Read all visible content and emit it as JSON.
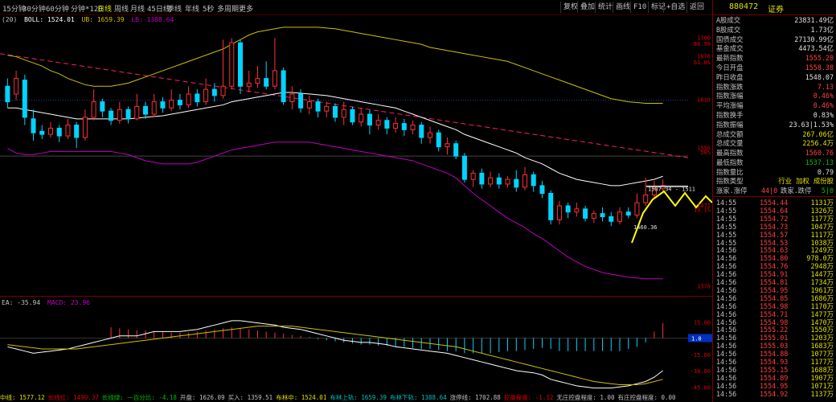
{
  "toolbar": {
    "timeframes": [
      "15分钟",
      "30分钟",
      "60分钟",
      "分钟*120",
      "日线",
      "周线",
      "月线",
      "45日线",
      "季线",
      "年线",
      "5秒",
      "多周期",
      "更多"
    ],
    "active_timeframe": "日线",
    "buttons": [
      "复权",
      "叠加",
      "统计",
      "画线",
      "F10",
      "标记",
      "+自选",
      "返回"
    ]
  },
  "main_header": {
    "label": "(20)  BOLL: 1524.01  UB: 1659.39  LB: 1388.64",
    "prefix": "(20)",
    "boll": "BOLL: 1524.01",
    "ub": "UB: 1659.39",
    "lb": "LB: 1388.64"
  },
  "price_labels": {
    "p1700": "1700",
    "p8099": "80.99",
    "p1676": "1676",
    "p6168": "61.8%",
    "p1610": "1610",
    "p1550": "1550",
    "p50": "50%",
    "p1471": "1471",
    "p1919": "19.1%",
    "p1370": "1370"
  },
  "annotations": {
    "range_label": "1507.34 - 1511",
    "low_label": "1460.36"
  },
  "macd_header": {
    "dea": "EA: -35.94",
    "macd": "MACD: 23.96"
  },
  "macd_labels": {
    "l1500": "15.00",
    "l000": "0.00",
    "l1500n": "-15.00",
    "l3000n": "-30.00",
    "l4500n": "-45.00",
    "box": "1.0"
  },
  "bottom_bar": [
    {
      "text": "中线: 1577.12",
      "color": "#e0e000"
    },
    {
      "text": "长线红: 1490.37",
      "color": "#e00000"
    },
    {
      "text": "长线绿: 一百分比: -4.18",
      "color": "#00c000"
    },
    {
      "text": "开盘: 1626.09",
      "color": "#c0c0c0"
    },
    {
      "text": "买入: 1359.51",
      "color": "#c0c0c0"
    },
    {
      "text": "布林中: 1524.01",
      "color": "#e0e000"
    },
    {
      "text": "布林上轨: 1659.39",
      "color": "#00c0c0"
    },
    {
      "text": "布林下轨: 1388.64",
      "color": "#00c0c0"
    },
    {
      "text": "涨停线: 1702.88",
      "color": "#c0c0c0"
    },
    {
      "text": "控盘程度: -1.12",
      "color": "#e00000"
    },
    {
      "text": "无庄控盘程度: 1.00",
      "color": "#c0c0c0"
    },
    {
      "text": "有庄控盘程度: 0.00",
      "color": "#c0c0c0"
    }
  ],
  "panel": {
    "code": "880472",
    "name": "证券",
    "rows": [
      {
        "k": "A股成交",
        "v": "23831.49亿",
        "c": "#e0e0e0"
      },
      {
        "k": "B股成交",
        "v": "1.73亿",
        "c": "#e0e0e0"
      },
      {
        "k": "国债成交",
        "v": "27130.99亿",
        "c": "#e0e0e0"
      },
      {
        "k": "基金成交",
        "v": "4473.54亿",
        "c": "#e0e0e0"
      },
      {
        "k": "最新指数",
        "v": "1555.20",
        "c": "#ff4040"
      },
      {
        "k": "今日开盘",
        "v": "1558.38",
        "c": "#ff4040"
      },
      {
        "k": "昨日收盘",
        "v": "1548.07",
        "c": "#e0e0e0"
      },
      {
        "k": "指数涨跌",
        "v": "7.13",
        "c": "#ff4040"
      },
      {
        "k": "指数涨幅",
        "v": "0.46%",
        "c": "#ff4040"
      },
      {
        "k": "平均涨幅",
        "v": "0.46%",
        "c": "#ff4040"
      },
      {
        "k": "指数换手",
        "v": "0.83%",
        "c": "#e0e0e0"
      },
      {
        "k": "指数振幅",
        "v": "23.63|1.53%",
        "c": "#e0e0e0"
      },
      {
        "k": "总成交额",
        "v": "267.06亿",
        "c": "#e0e000"
      },
      {
        "k": "总成交量",
        "v": "2256.4万",
        "c": "#e0e000"
      },
      {
        "k": "最高指数",
        "v": "1560.76",
        "c": "#ff4040"
      },
      {
        "k": "最低指数",
        "v": "1537.13",
        "c": "#00c000"
      },
      {
        "k": "指数量比",
        "v": "0.79",
        "c": "#e0e0e0"
      }
    ],
    "type_row": {
      "k": "指数类型",
      "v": "行业 加权 成份股"
    },
    "updown_row": {
      "k": "涨家.涨停",
      "v": "44|0",
      "k2": "跌家.跌停",
      "v2": "5|0"
    },
    "ticks": [
      {
        "t": "14:55",
        "p": "1554.44",
        "v": "1131万"
      },
      {
        "t": "14:55",
        "p": "1554.64",
        "v": "1326万"
      },
      {
        "t": "14:55",
        "p": "1554.72",
        "v": "1177万"
      },
      {
        "t": "14:55",
        "p": "1554.73",
        "v": "1047万"
      },
      {
        "t": "14:55",
        "p": "1554.57",
        "v": "1117万"
      },
      {
        "t": "14:55",
        "p": "1554.53",
        "v": "1038万"
      },
      {
        "t": "14:56",
        "p": "1554.63",
        "v": "1249万"
      },
      {
        "t": "14:56",
        "p": "1554.80",
        "v": "978.0万"
      },
      {
        "t": "14:56",
        "p": "1554.76",
        "v": "2948万"
      },
      {
        "t": "14:56",
        "p": "1554.91",
        "v": "1447万"
      },
      {
        "t": "14:56",
        "p": "1554.81",
        "v": "1734万"
      },
      {
        "t": "14:56",
        "p": "1554.95",
        "v": "1961万"
      },
      {
        "t": "14:56",
        "p": "1554.85",
        "v": "1686万"
      },
      {
        "t": "14:56",
        "p": "1554.98",
        "v": "1170万"
      },
      {
        "t": "14:56",
        "p": "1554.71",
        "v": "1477万"
      },
      {
        "t": "14:56",
        "p": "1554.98",
        "v": "1470万"
      },
      {
        "t": "14:56",
        "p": "1555.22",
        "v": "1550万"
      },
      {
        "t": "14:56",
        "p": "1555.01",
        "v": "1203万"
      },
      {
        "t": "14:56",
        "p": "1555.03",
        "v": "1683万"
      },
      {
        "t": "14:56",
        "p": "1554.88",
        "v": "1077万"
      },
      {
        "t": "14:56",
        "p": "1554.93",
        "v": "1177万"
      },
      {
        "t": "14:56",
        "p": "1555.15",
        "v": "1688万"
      },
      {
        "t": "14:56",
        "p": "1554.89",
        "v": "1907万"
      },
      {
        "t": "14:56",
        "p": "1554.95",
        "v": "1071万"
      },
      {
        "t": "14:56",
        "p": "1554.92",
        "v": "1137万"
      }
    ]
  },
  "colors": {
    "up": "#ff3030",
    "down": "#00d4ff",
    "boll_mid": "#ffffff",
    "boll_up": "#d0c000",
    "boll_low": "#c000c0",
    "trend": "#ff2060",
    "panel_border": "#7a0000"
  },
  "chart_data": {
    "type": "candlestick",
    "ylim": [
      1370,
      1720
    ],
    "candles": [
      [
        1640,
        1620,
        1650,
        1612
      ],
      [
        1630,
        1650,
        1660,
        1622
      ],
      [
        1648,
        1600,
        1655,
        1590
      ],
      [
        1598,
        1580,
        1610,
        1570
      ],
      [
        1582,
        1578,
        1590,
        1572
      ],
      [
        1578,
        1586,
        1594,
        1574
      ],
      [
        1586,
        1576,
        1590,
        1568
      ],
      [
        1576,
        1590,
        1598,
        1572
      ],
      [
        1590,
        1574,
        1594,
        1560
      ],
      [
        1574,
        1600,
        1610,
        1570
      ],
      [
        1600,
        1620,
        1636,
        1596
      ],
      [
        1620,
        1608,
        1624,
        1600
      ],
      [
        1608,
        1596,
        1612,
        1590
      ],
      [
        1596,
        1610,
        1620,
        1592
      ],
      [
        1610,
        1598,
        1614,
        1592
      ],
      [
        1598,
        1614,
        1630,
        1596
      ],
      [
        1614,
        1604,
        1620,
        1598
      ],
      [
        1604,
        1620,
        1630,
        1600
      ],
      [
        1620,
        1612,
        1626,
        1606
      ],
      [
        1612,
        1622,
        1636,
        1608
      ],
      [
        1622,
        1616,
        1630,
        1610
      ],
      [
        1616,
        1630,
        1640,
        1612
      ],
      [
        1630,
        1620,
        1636,
        1614
      ],
      [
        1620,
        1636,
        1650,
        1616
      ],
      [
        1636,
        1628,
        1644,
        1620
      ],
      [
        1628,
        1640,
        1700,
        1624
      ],
      [
        1640,
        1696,
        1702,
        1636
      ],
      [
        1696,
        1640,
        1700,
        1630
      ],
      [
        1640,
        1644,
        1660,
        1632
      ],
      [
        1644,
        1650,
        1666,
        1638
      ],
      [
        1650,
        1640,
        1672,
        1636
      ],
      [
        1640,
        1660,
        1702,
        1636
      ],
      [
        1660,
        1620,
        1664,
        1616
      ],
      [
        1620,
        1630,
        1640,
        1610
      ],
      [
        1630,
        1612,
        1636,
        1606
      ],
      [
        1612,
        1620,
        1628,
        1604
      ],
      [
        1620,
        1608,
        1624,
        1600
      ],
      [
        1608,
        1614,
        1620,
        1600
      ],
      [
        1614,
        1600,
        1618,
        1594
      ],
      [
        1600,
        1610,
        1620,
        1590
      ],
      [
        1610,
        1594,
        1614,
        1590
      ],
      [
        1594,
        1604,
        1612,
        1588
      ],
      [
        1604,
        1590,
        1610,
        1578
      ],
      [
        1590,
        1596,
        1604,
        1584
      ],
      [
        1596,
        1586,
        1600,
        1578
      ],
      [
        1586,
        1592,
        1600,
        1580
      ],
      [
        1592,
        1584,
        1598,
        1576
      ],
      [
        1584,
        1590,
        1596,
        1578
      ],
      [
        1590,
        1574,
        1594,
        1566
      ],
      [
        1574,
        1580,
        1588,
        1566
      ],
      [
        1580,
        1562,
        1584,
        1556
      ],
      [
        1562,
        1566,
        1574,
        1552
      ],
      [
        1566,
        1550,
        1570,
        1546
      ],
      [
        1550,
        1520,
        1554,
        1516
      ],
      [
        1520,
        1528,
        1532,
        1510
      ],
      [
        1528,
        1514,
        1534,
        1508
      ],
      [
        1514,
        1522,
        1530,
        1510
      ],
      [
        1522,
        1514,
        1528,
        1508
      ],
      [
        1514,
        1520,
        1524,
        1510
      ],
      [
        1520,
        1510,
        1532,
        1504
      ],
      [
        1510,
        1526,
        1536,
        1506
      ],
      [
        1526,
        1512,
        1530,
        1504
      ],
      [
        1512,
        1502,
        1518,
        1496
      ],
      [
        1502,
        1468,
        1506,
        1462
      ],
      [
        1468,
        1486,
        1492,
        1462
      ],
      [
        1486,
        1478,
        1490,
        1470
      ],
      [
        1478,
        1482,
        1490,
        1472
      ],
      [
        1482,
        1470,
        1486,
        1466
      ],
      [
        1470,
        1476,
        1480,
        1464
      ],
      [
        1476,
        1472,
        1484,
        1466
      ],
      [
        1472,
        1466,
        1478,
        1460
      ],
      [
        1466,
        1478,
        1484,
        1462
      ],
      [
        1478,
        1474,
        1484,
        1470
      ],
      [
        1474,
        1490,
        1502,
        1470
      ],
      [
        1490,
        1500,
        1522,
        1486
      ],
      [
        1500,
        1508,
        1518,
        1496
      ],
      [
        1508,
        1512,
        1520,
        1506
      ]
    ],
    "boll_mid": [
      1612,
      1612,
      1610,
      1608,
      1606,
      1604,
      1602,
      1600,
      1598,
      1598,
      1598,
      1598,
      1598,
      1598,
      1598,
      1599,
      1600,
      1601,
      1602,
      1604,
      1606,
      1608,
      1610,
      1612,
      1614,
      1616,
      1620,
      1622,
      1624,
      1626,
      1628,
      1630,
      1632,
      1632,
      1631,
      1630,
      1629,
      1628,
      1626,
      1624,
      1622,
      1620,
      1618,
      1616,
      1614,
      1612,
      1608,
      1604,
      1600,
      1596,
      1592,
      1588,
      1584,
      1578,
      1574,
      1570,
      1566,
      1562,
      1558,
      1554,
      1548,
      1544,
      1540,
      1534,
      1528,
      1524,
      1520,
      1518,
      1516,
      1514,
      1512,
      1512,
      1514,
      1516,
      1518,
      1520,
      1524
    ],
    "boll_up": [
      1680,
      1678,
      1674,
      1670,
      1666,
      1660,
      1656,
      1650,
      1646,
      1642,
      1640,
      1640,
      1640,
      1642,
      1644,
      1648,
      1652,
      1656,
      1660,
      1664,
      1668,
      1672,
      1676,
      1680,
      1684,
      1688,
      1694,
      1700,
      1706,
      1710,
      1712,
      1714,
      1716,
      1716,
      1716,
      1716,
      1716,
      1715,
      1714,
      1712,
      1710,
      1708,
      1706,
      1704,
      1702,
      1700,
      1698,
      1696,
      1694,
      1690,
      1688,
      1686,
      1684,
      1682,
      1680,
      1678,
      1676,
      1674,
      1672,
      1668,
      1664,
      1660,
      1656,
      1652,
      1648,
      1644,
      1640,
      1636,
      1632,
      1628,
      1624,
      1622,
      1620,
      1619,
      1618,
      1618,
      1618
    ],
    "boll_low": [
      1560,
      1554,
      1552,
      1552,
      1554,
      1556,
      1556,
      1556,
      1556,
      1556,
      1556,
      1556,
      1556,
      1554,
      1552,
      1548,
      1544,
      1542,
      1540,
      1540,
      1540,
      1540,
      1542,
      1546,
      1550,
      1554,
      1558,
      1560,
      1562,
      1564,
      1566,
      1568,
      1568,
      1568,
      1568,
      1568,
      1566,
      1564,
      1562,
      1560,
      1558,
      1556,
      1554,
      1552,
      1550,
      1548,
      1546,
      1544,
      1540,
      1536,
      1532,
      1528,
      1522,
      1512,
      1502,
      1494,
      1486,
      1478,
      1470,
      1464,
      1458,
      1450,
      1444,
      1436,
      1428,
      1420,
      1414,
      1408,
      1404,
      1400,
      1398,
      1396,
      1394,
      1393,
      1392,
      1392,
      1392
    ],
    "macd_hist": [
      0,
      0,
      0,
      0,
      0,
      0,
      0,
      0,
      0,
      0,
      0,
      0,
      10,
      9,
      8,
      7,
      7,
      6,
      6,
      5,
      5,
      5,
      6,
      7,
      8,
      9,
      10,
      9,
      8,
      7,
      6,
      5,
      4,
      3,
      2,
      1,
      -1,
      -2,
      -3,
      -4,
      -5,
      -6,
      -6,
      -7,
      -7,
      -8,
      -8,
      -9,
      -10,
      -10,
      -11,
      -12,
      -12,
      -14,
      -14,
      -14,
      -14,
      -13,
      -12,
      -12,
      -11,
      -10,
      -9,
      -10,
      -12,
      -12,
      -12,
      -12,
      -12,
      -12,
      -12,
      -12,
      -10,
      -8,
      -4,
      6,
      14
    ],
    "dif": [
      -8,
      -10,
      -12,
      -14,
      -13,
      -12,
      -11,
      -10,
      -8,
      -6,
      -4,
      -2,
      0,
      2,
      2,
      2,
      4,
      6,
      6,
      6,
      6,
      7,
      8,
      10,
      12,
      14,
      16,
      16,
      15,
      14,
      13,
      12,
      10,
      9,
      8,
      6,
      4,
      2,
      0,
      -2,
      -3,
      -4,
      -4,
      -5,
      -6,
      -8,
      -9,
      -10,
      -11,
      -12,
      -13,
      -14,
      -16,
      -18,
      -20,
      -22,
      -24,
      -26,
      -28,
      -30,
      -31,
      -32,
      -34,
      -38,
      -40,
      -42,
      -44,
      -45,
      -46,
      -46,
      -46,
      -45,
      -44,
      -42,
      -40,
      -36,
      -30
    ],
    "dea": [
      -6,
      -7,
      -8,
      -9,
      -10,
      -10,
      -10,
      -10,
      -10,
      -9,
      -8,
      -7,
      -6,
      -5,
      -4,
      -3,
      -2,
      -1,
      0,
      1,
      2,
      3,
      4,
      5,
      6,
      7,
      8,
      9,
      10,
      11,
      11,
      11,
      11,
      11,
      10,
      9,
      8,
      7,
      6,
      5,
      4,
      3,
      2,
      1,
      0,
      -1,
      -2,
      -3,
      -4,
      -5,
      -6,
      -7,
      -8,
      -10,
      -12,
      -14,
      -16,
      -18,
      -20,
      -22,
      -24,
      -26,
      -28,
      -30,
      -32,
      -34,
      -36,
      -38,
      -40,
      -41,
      -42,
      -43,
      -43,
      -43,
      -42,
      -40,
      -38
    ],
    "macd_ylim": [
      -50,
      30
    ]
  }
}
